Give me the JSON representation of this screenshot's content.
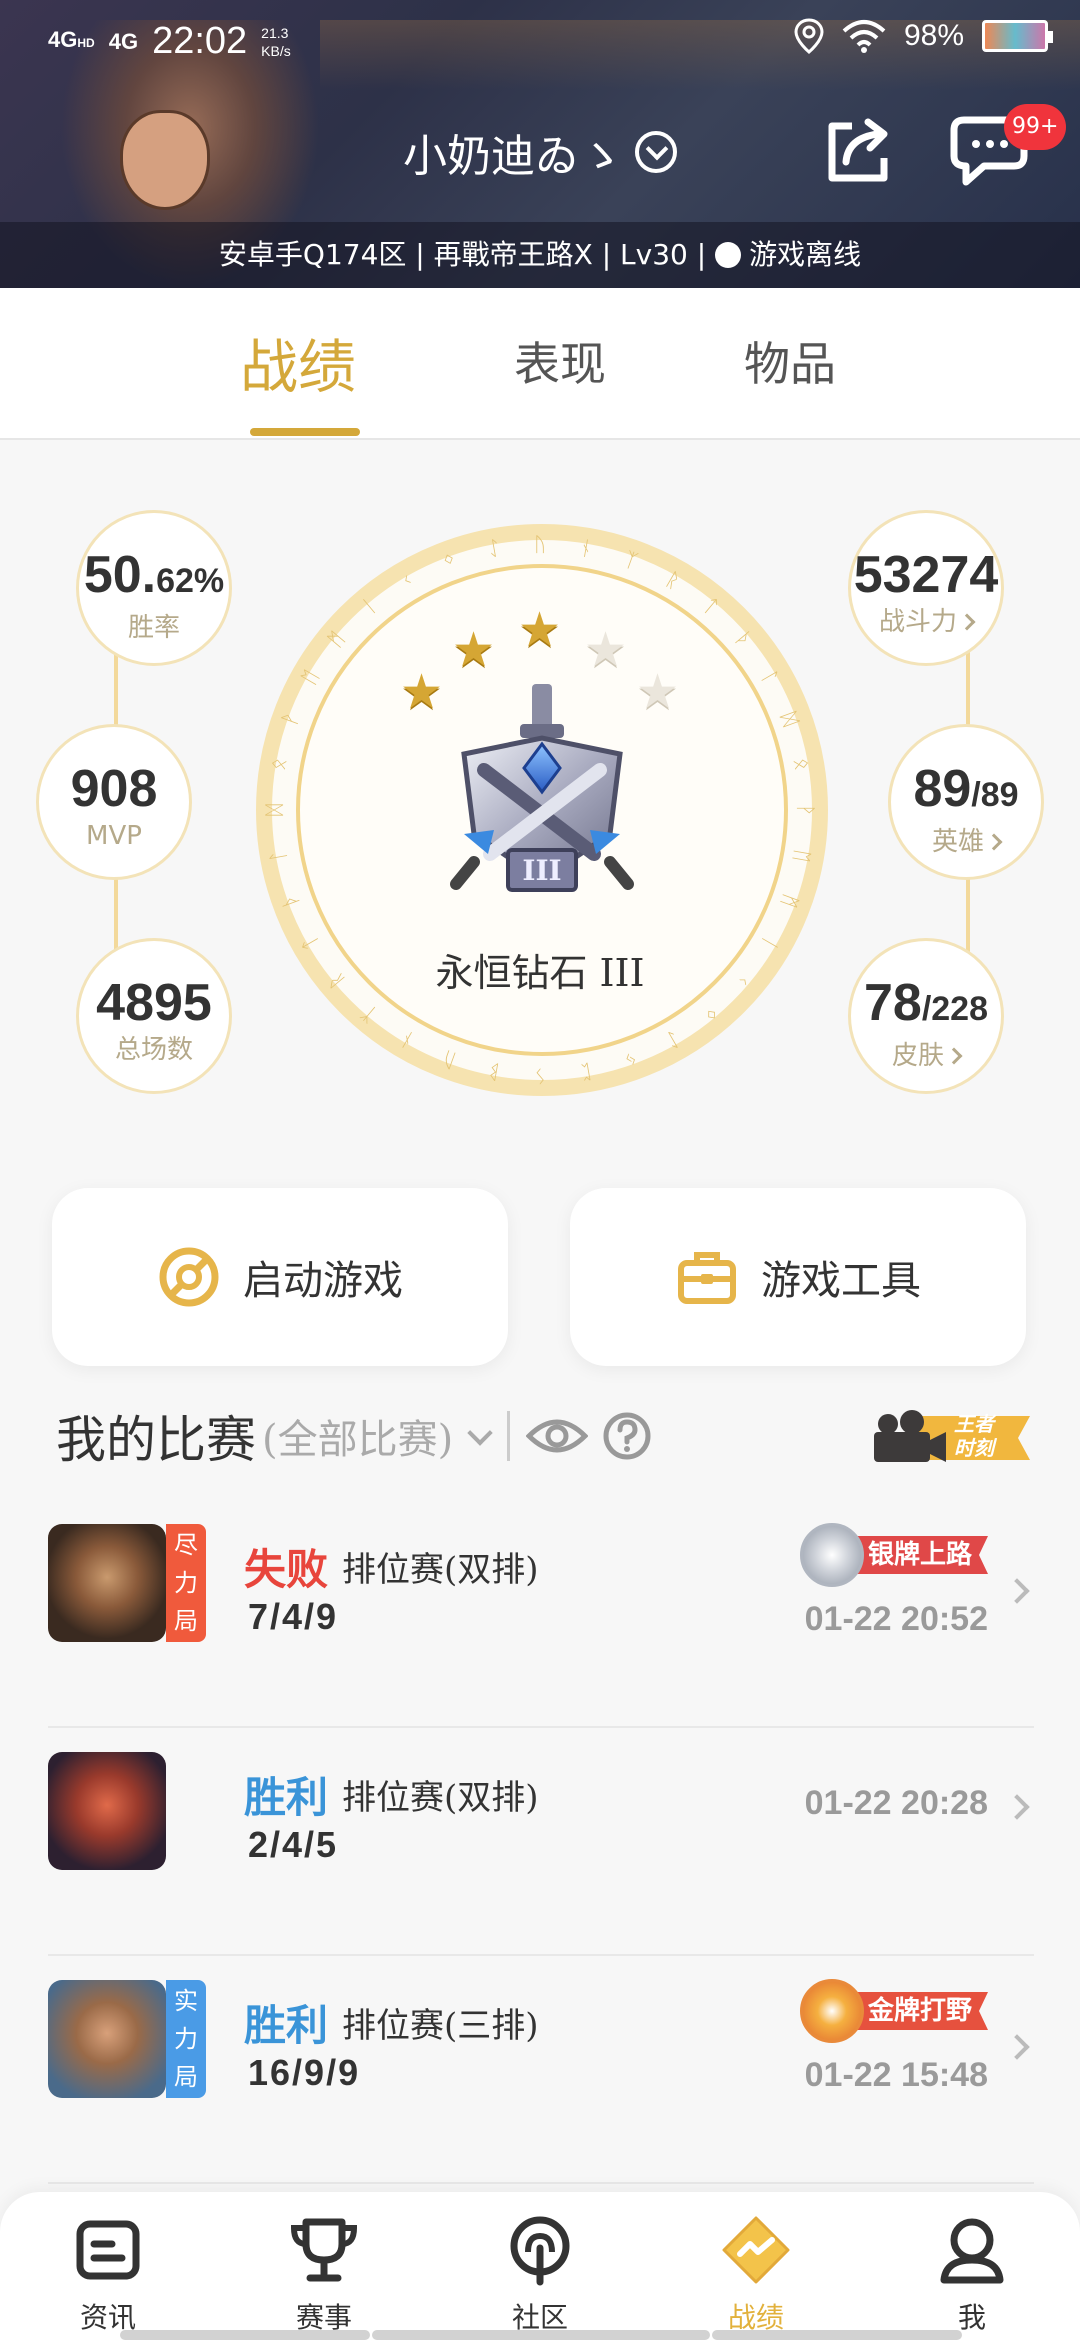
{
  "status_bar": {
    "network1": "4G",
    "network1_sup": "HD",
    "network2": "4G",
    "time": "22:02",
    "speed_value": "21.3",
    "speed_unit": "KB/s",
    "battery": "98%"
  },
  "profile": {
    "username": "小奶迪ゐゝ",
    "message_badge": "99+",
    "server_info": "安卓手Q174区 | 再戰帝王路X | Lv30 | ",
    "online_status": "游戏离线"
  },
  "tabs": [
    {
      "label": "战绩",
      "active": true
    },
    {
      "label": "表现",
      "active": false
    },
    {
      "label": "物品",
      "active": false
    }
  ],
  "stats": {
    "win_rate": {
      "value": "50.",
      "value_small": "62%",
      "label": "胜率"
    },
    "mvp": {
      "value": "908",
      "label": "MVP"
    },
    "total_games": {
      "value": "4895",
      "label": "总场数"
    },
    "power": {
      "value": "53274",
      "label": "战斗力"
    },
    "heroes": {
      "value": "89",
      "value_small": "/89",
      "label": "英雄"
    },
    "skins": {
      "value": "78",
      "value_small": "/228",
      "label": "皮肤"
    }
  },
  "rank": {
    "name": "永恒钻石 III",
    "stars_filled": 3,
    "stars_total": 5
  },
  "actions": {
    "launch_game": "启动游戏",
    "game_tools": "游戏工具"
  },
  "matches_header": {
    "title": "我的比赛",
    "filter": "(全部比赛)",
    "badge_line1": "王者",
    "badge_line2": "时刻"
  },
  "matches": [
    {
      "result": "失败",
      "result_type": "lose",
      "tag": "尽力局",
      "tag_color": "#f05a3c",
      "mode": "排位赛(双排)",
      "kda": "7/4/9",
      "medal": "银牌上路",
      "medal_color": "#e04848",
      "time": "01-22 20:52"
    },
    {
      "result": "胜利",
      "result_type": "win",
      "tag": "",
      "tag_color": "",
      "mode": "排位赛(双排)",
      "kda": "2/4/5",
      "medal": "",
      "medal_color": "",
      "time": "01-22 20:28"
    },
    {
      "result": "胜利",
      "result_type": "win",
      "tag": "实力局",
      "tag_color": "#4a9be6",
      "mode": "排位赛(三排)",
      "kda": "16/9/9",
      "medal": "金牌打野",
      "medal_color": "#e6513e",
      "time": "01-22 15:48"
    }
  ],
  "nav": [
    {
      "label": "资讯",
      "icon": "news-icon",
      "active": false
    },
    {
      "label": "赛事",
      "icon": "trophy-icon",
      "active": false
    },
    {
      "label": "社区",
      "icon": "community-icon",
      "active": false
    },
    {
      "label": "战绩",
      "icon": "record-icon",
      "active": true
    },
    {
      "label": "我",
      "icon": "profile-icon",
      "active": false
    }
  ],
  "colors": {
    "accent_gold": "#d4a83a",
    "lose_red": "#e8453c",
    "win_blue": "#3a94d8"
  }
}
